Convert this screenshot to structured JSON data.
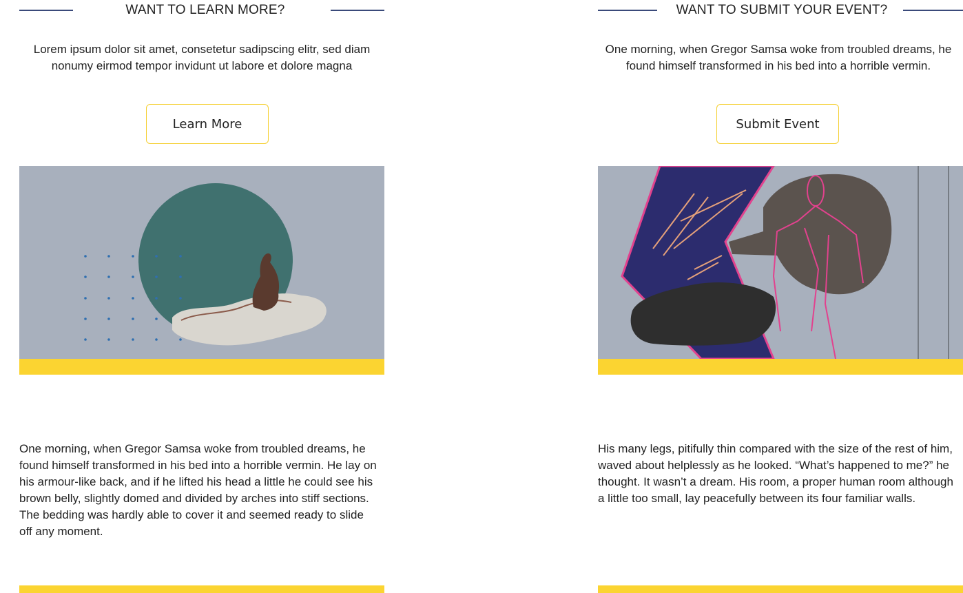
{
  "left": {
    "heading": "WANT TO LEARN MORE?",
    "intro": "Lorem ipsum dolor sit amet, consetetur sadipscing elitr, sed diam nonumy eirmod tempor invidunt ut labore et dolore magna",
    "button_label": "Learn More",
    "body": "One morning, when Gregor Samsa woke from troubled dreams, he found himself transformed in his bed into a horrible vermin. He lay on his armour-like back, and if he lifted his head a little he could see his brown belly, slightly domed and divided by arches into stiff sections. The bedding was hardly able to cover it and seemed ready to slide off any moment."
  },
  "right": {
    "heading": "WANT TO SUBMIT YOUR EVENT?",
    "intro": "One morning, when Gregor Samsa woke from troubled dreams, he found himself transformed in his bed into a horrible vermin.",
    "button_label": "Submit Event",
    "body": "His many legs, pitifully thin compared with the size of the rest of him, waved about helplessly as he looked. “What’s happened to me?” he thought. It wasn’t a dream. His room, a proper human room although a little too small, lay peacefully between its four familiar walls."
  },
  "colors": {
    "accent_yellow": "#fbd431",
    "rule_navy": "#3a4a7a",
    "image_bg": "#a8b0bd",
    "teal_circle": "#40716f",
    "dot_blue": "#2f6fb0",
    "navy_shape": "#2c2c6e",
    "pink_line": "#e2428e"
  }
}
